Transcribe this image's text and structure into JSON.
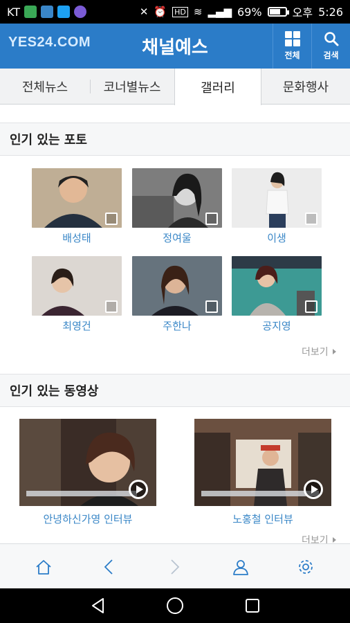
{
  "status_bar": {
    "carrier": "KT",
    "battery": "69%",
    "battery_level": 0.69,
    "time_period": "오후",
    "time": "5:26"
  },
  "header": {
    "logo": "YES24.COM",
    "title": "채널예스",
    "all_label": "전체",
    "search_label": "검색"
  },
  "tabs": [
    "전체뉴스",
    "코너별뉴스",
    "갤러리",
    "문화행사"
  ],
  "active_tab": "갤러리",
  "photos_section": {
    "title": "인기 있는 포토",
    "items": [
      {
        "name": "배성태",
        "bg": "#c7b79f"
      },
      {
        "name": "정여울",
        "bg": "#8a8a8a"
      },
      {
        "name": "이생",
        "bg": "#e6e6e6"
      },
      {
        "name": "최영건",
        "bg": "#d9d4cf"
      },
      {
        "name": "주한나",
        "bg": "#6b7a86"
      },
      {
        "name": "공지영",
        "bg": "#3d9a94"
      }
    ],
    "more": "더보기"
  },
  "videos_section": {
    "title": "인기 있는 동영상",
    "items": [
      {
        "title": "안녕하신가영 인터뷰"
      },
      {
        "title": "노홍철 인터뷰"
      }
    ],
    "more": "더보기"
  },
  "toolbar": {
    "items": [
      "home-icon",
      "back-icon",
      "forward-icon",
      "user-icon",
      "settings-icon"
    ],
    "color": "#2b7cc8"
  },
  "colors": {
    "brand": "#2b7cc8",
    "link": "#3a87c7"
  }
}
